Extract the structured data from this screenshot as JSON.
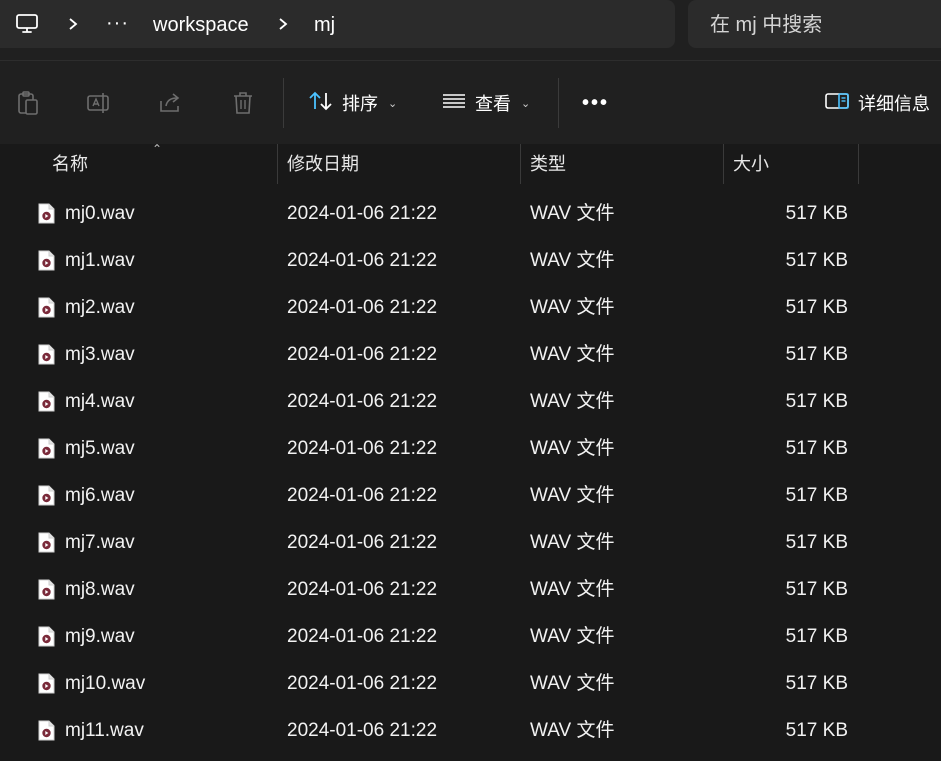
{
  "address_bar": {
    "pc_icon": "computer-icon",
    "chevron_icon": "chevron-right-icon",
    "overflow_label": "···",
    "crumbs": [
      "workspace",
      "mj"
    ]
  },
  "search": {
    "placeholder": "在 mj 中搜索"
  },
  "toolbar": {
    "icons": [
      "paste-icon",
      "rename-icon",
      "share-icon",
      "delete-icon"
    ],
    "sort_label": "排序",
    "view_label": "查看",
    "more_label": "•••",
    "details_label": "详细信息"
  },
  "columns": {
    "name": "名称",
    "date": "修改日期",
    "type": "类型",
    "size": "大小"
  },
  "files": [
    {
      "name": "mj0.wav",
      "date": "2024-01-06 21:22",
      "type": "WAV 文件",
      "size": "517 KB"
    },
    {
      "name": "mj1.wav",
      "date": "2024-01-06 21:22",
      "type": "WAV 文件",
      "size": "517 KB"
    },
    {
      "name": "mj2.wav",
      "date": "2024-01-06 21:22",
      "type": "WAV 文件",
      "size": "517 KB"
    },
    {
      "name": "mj3.wav",
      "date": "2024-01-06 21:22",
      "type": "WAV 文件",
      "size": "517 KB"
    },
    {
      "name": "mj4.wav",
      "date": "2024-01-06 21:22",
      "type": "WAV 文件",
      "size": "517 KB"
    },
    {
      "name": "mj5.wav",
      "date": "2024-01-06 21:22",
      "type": "WAV 文件",
      "size": "517 KB"
    },
    {
      "name": "mj6.wav",
      "date": "2024-01-06 21:22",
      "type": "WAV 文件",
      "size": "517 KB"
    },
    {
      "name": "mj7.wav",
      "date": "2024-01-06 21:22",
      "type": "WAV 文件",
      "size": "517 KB"
    },
    {
      "name": "mj8.wav",
      "date": "2024-01-06 21:22",
      "type": "WAV 文件",
      "size": "517 KB"
    },
    {
      "name": "mj9.wav",
      "date": "2024-01-06 21:22",
      "type": "WAV 文件",
      "size": "517 KB"
    },
    {
      "name": "mj10.wav",
      "date": "2024-01-06 21:22",
      "type": "WAV 文件",
      "size": "517 KB"
    },
    {
      "name": "mj11.wav",
      "date": "2024-01-06 21:22",
      "type": "WAV 文件",
      "size": "517 KB"
    }
  ],
  "colors": {
    "background": "#191919",
    "toolbar": "#202020",
    "bar_field": "#2b2b2b",
    "accent_icon": "#4cc2ff",
    "file_icon_accent": "#7a2a3a"
  }
}
